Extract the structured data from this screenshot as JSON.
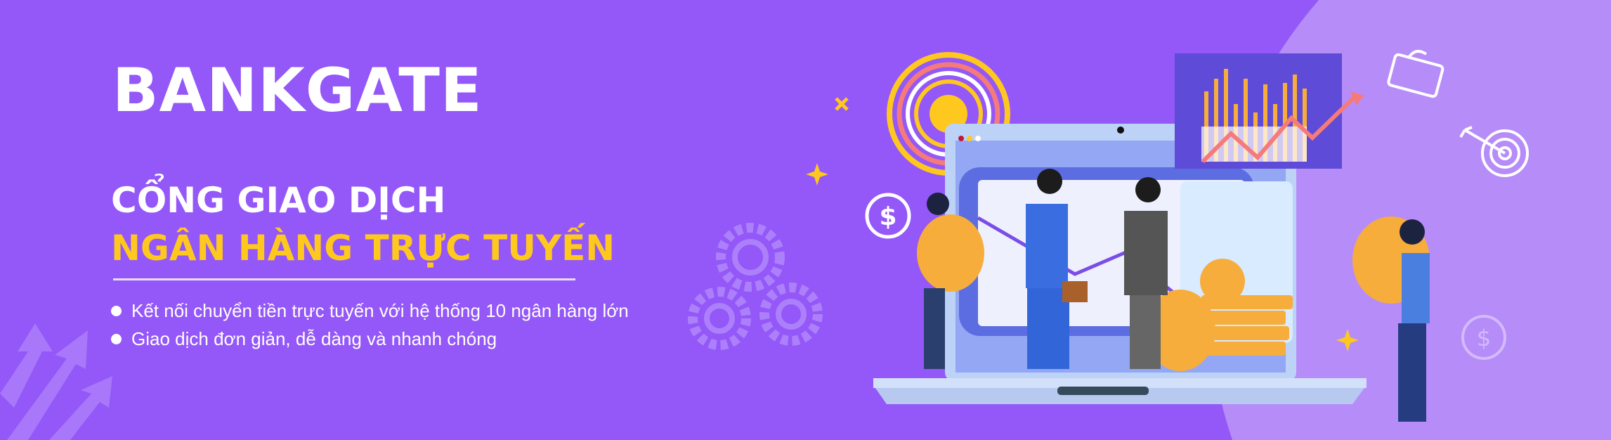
{
  "banner": {
    "brand": "BANKGATE",
    "headline_line1": "CỔNG GIAO DỊCH",
    "headline_line2": "NGÂN HÀNG TRỰC TUYẾN",
    "bullets": [
      "Kết nối chuyển tiền trực tuyến với hệ thống 10 ngân hàng lớn",
      "Giao dịch đơn giản, dễ dàng và nhanh chóng"
    ]
  },
  "colors": {
    "background": "#9457f8",
    "accent_circle": "#b68cf9",
    "headline_accent": "#ffc81e",
    "coin": "#f7ad3c"
  },
  "illustration": {
    "icons": [
      "target-icon",
      "gear-icon",
      "dollar-badge-icon",
      "briefcase-icon",
      "dartboard-icon",
      "sparkle-icon",
      "arrow-up-icon",
      "bar-chart-icon",
      "laptop-icon",
      "coin-icon"
    ]
  }
}
